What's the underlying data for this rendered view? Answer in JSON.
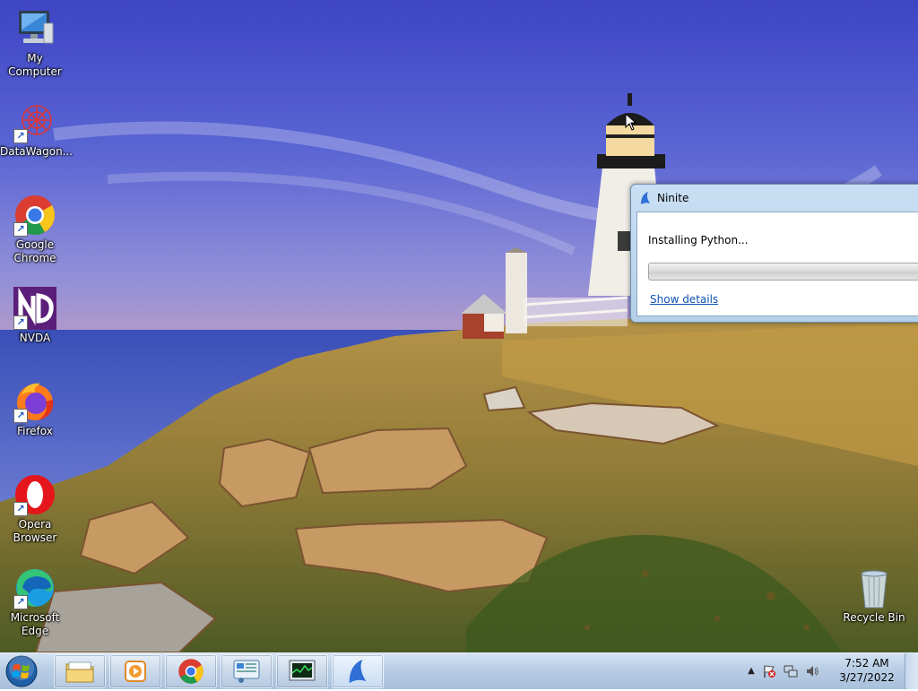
{
  "desktop": {
    "icons": [
      {
        "label": "My Computer",
        "icon": "computer-icon",
        "shortcut": false
      },
      {
        "label": "DataWagon...",
        "icon": "datawagon-icon",
        "shortcut": true
      },
      {
        "label": "Google Chrome",
        "icon": "chrome-icon",
        "shortcut": true
      },
      {
        "label": "NVDA",
        "icon": "nvda-icon",
        "shortcut": true
      },
      {
        "label": "Firefox",
        "icon": "firefox-icon",
        "shortcut": true
      },
      {
        "label": "Opera Browser",
        "icon": "opera-icon",
        "shortcut": true
      },
      {
        "label": "Microsoft Edge",
        "icon": "edge-icon",
        "shortcut": true
      },
      {
        "label": "Recycle Bin",
        "icon": "recycle-bin-icon",
        "shortcut": false
      }
    ],
    "shortcut_arrow": "↗"
  },
  "ninite": {
    "title": "Ninite",
    "status": "Installing Python...",
    "progress": 0,
    "details_link": "Show details"
  },
  "taskbar": {
    "pinned": [
      {
        "name": "file-explorer",
        "icon": "folder-icon",
        "active": false
      },
      {
        "name": "media-player",
        "icon": "media-player-icon",
        "active": false
      },
      {
        "name": "chrome",
        "icon": "chrome-icon",
        "active": false
      },
      {
        "name": "control-panel",
        "icon": "control-panel-icon",
        "active": false
      },
      {
        "name": "task-manager",
        "icon": "task-manager-icon",
        "active": false
      },
      {
        "name": "ninite",
        "icon": "ninite-icon",
        "active": true
      }
    ],
    "tray_icons": [
      "show-hidden-icons-arrow",
      "action-center-flag-icon",
      "network-icon",
      "volume-icon"
    ],
    "clock": {
      "time": "7:52 AM",
      "date": "3/27/2022"
    }
  },
  "colors": {
    "link": "#0c52b8",
    "taskbar": "#b8cde4",
    "title_text": "#000000"
  }
}
